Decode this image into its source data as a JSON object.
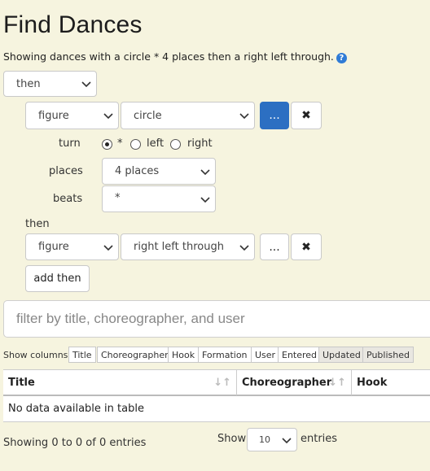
{
  "page": {
    "title": "Find Dances",
    "subtitle": "Showing dances with a circle * 4 places then a right left through.",
    "help_icon": "?"
  },
  "query": {
    "root_op": "then",
    "clause1": {
      "kind": "figure",
      "figure": "circle",
      "more_label": "...",
      "remove_icon": "✖",
      "turn_label": "turn",
      "turn_options": [
        "*",
        "left",
        "right"
      ],
      "turn_selected": "*",
      "places_label": "places",
      "places_value": "4 places",
      "beats_label": "beats",
      "beats_value": "*"
    },
    "then_label": "then",
    "clause2": {
      "kind": "figure",
      "figure": "right left through",
      "more_label": "...",
      "remove_icon": "✖"
    },
    "add_then_label": "add then"
  },
  "filter": {
    "placeholder": "filter by title, choreographer, and user"
  },
  "columns": {
    "label": "Show columns",
    "items": [
      "Title",
      "Choreographer",
      "Hook",
      "Formation",
      "User",
      "Entered",
      "Updated",
      "Published"
    ],
    "active": [
      "Updated",
      "Published"
    ]
  },
  "table": {
    "headers": [
      "Title",
      "Choreographer",
      "Hook"
    ],
    "empty_text": "No data available in table"
  },
  "footer": {
    "info": "Showing 0 to 0 of 0 entries",
    "show_label": "Show",
    "page_length": "10",
    "entries_label": "entries"
  },
  "colors": {
    "background": "#f6f4df",
    "primary": "#2c6fc2",
    "help": "#2f7bd6"
  }
}
